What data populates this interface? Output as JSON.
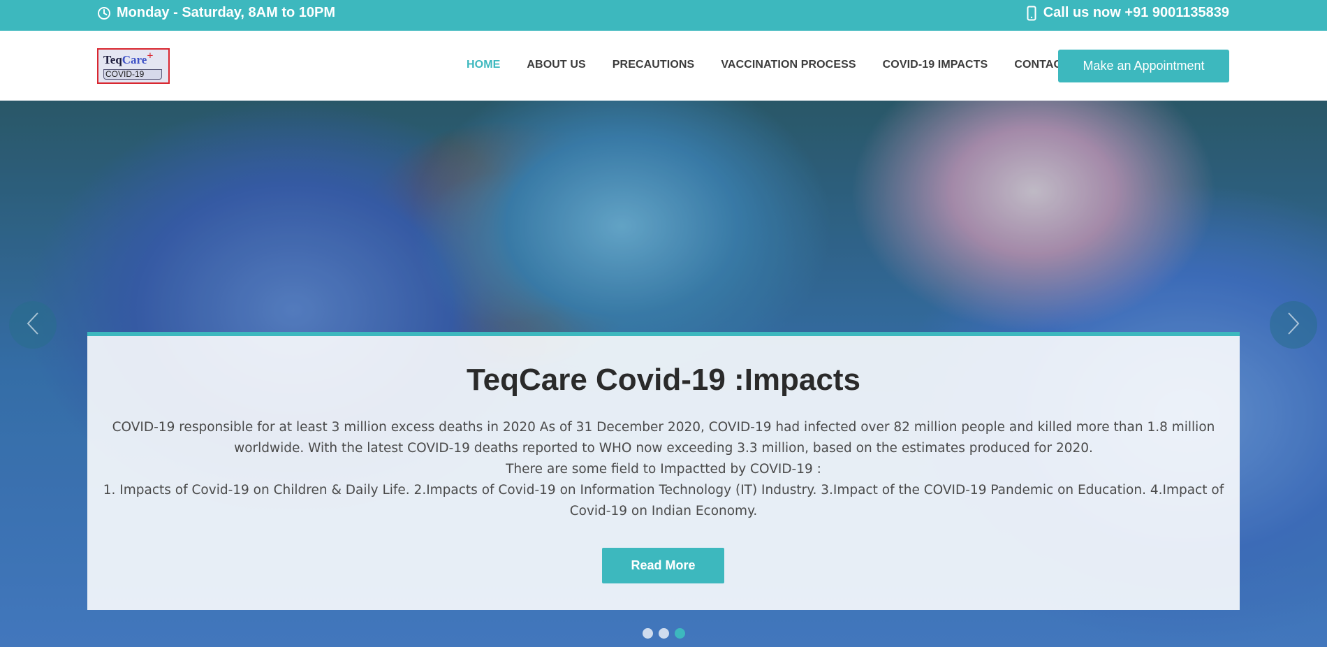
{
  "topbar": {
    "hours": "Monday - Saturday, 8AM to 10PM",
    "phone": "Call us now +91 9001135839",
    "hours_icon": "clock-icon",
    "phone_icon": "mobile-phone-icon"
  },
  "logo": {
    "teq": "Teq",
    "care": "Care",
    "plus": "+",
    "sub": "COVID-19"
  },
  "nav": {
    "items": [
      {
        "label": "HOME",
        "active": true
      },
      {
        "label": "ABOUT US"
      },
      {
        "label": "PRECAUTIONS"
      },
      {
        "label": "VACCINATION PROCESS"
      },
      {
        "label": "COVID-19 IMPACTS"
      },
      {
        "label": "CONTACT"
      }
    ],
    "cta_label": "Make an Appointment"
  },
  "hero": {
    "title": "TeqCare Covid-19 :Impacts",
    "line1": "COVID-19 responsible for at least 3 million excess deaths in 2020 As of 31 December 2020, COVID-19 had infected over 82 million people and killed more than 1.8 million worldwide. With the latest COVID-19 deaths reported to WHO now exceeding 3.3 million, based on the estimates produced for 2020.",
    "line2": "There are some field to Impactted by COVID-19 :",
    "line3": "1. Impacts of Covid-19 on Children & Daily Life. 2.Impacts of Covid-19 on Information Technology (IT) Industry. 3.Impact of the COVID-19 Pandemic on Education. 4.Impact of Covid-19 on Indian Economy.",
    "button_label": "Read More",
    "slides_total": 3,
    "slide_active": 3
  },
  "colors": {
    "accent": "#3db8be",
    "logo_border": "#d9262f"
  }
}
